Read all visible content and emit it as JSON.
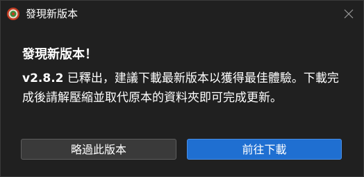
{
  "window": {
    "title": "發現新版本",
    "app_icon": "app-logo-icon",
    "close_icon": "close-icon"
  },
  "dialog": {
    "heading": "發現新版本！",
    "version": "v2.8.2",
    "message_after_version": " 已釋出，建議下載最新版本以獲得最佳體驗。下載完成後請解壓縮並取代原本的資料夾即可完成更新。"
  },
  "buttons": {
    "skip_label": "略過此版本",
    "download_label": "前往下載"
  },
  "colors": {
    "background": "#202020",
    "primary_button": "#1f6fd1",
    "secondary_button": "#3a3a3a"
  }
}
